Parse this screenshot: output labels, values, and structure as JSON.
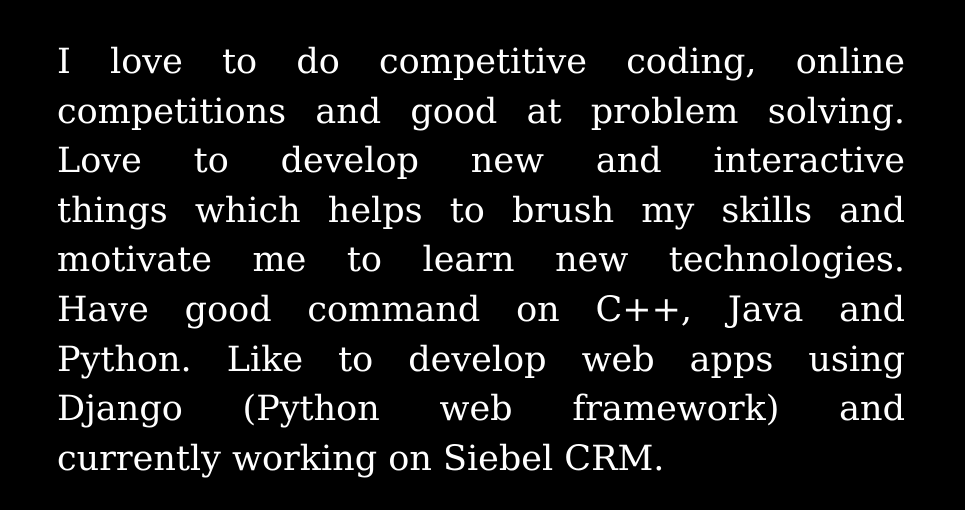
{
  "bio": {
    "lines": [
      "I love to do competitive coding, online",
      "competitions and good at problem solving.",
      "Love to develop new and interactive",
      "things which helps to brush my skills and",
      "motivate me to learn new technologies.",
      "Have good command on C++, Java and",
      "Python. Like to develop web apps using",
      "Django (Python web framework) and",
      "currently working on Siebel CRM."
    ]
  },
  "colors": {
    "background": "#000000",
    "text": "#ffffff"
  }
}
